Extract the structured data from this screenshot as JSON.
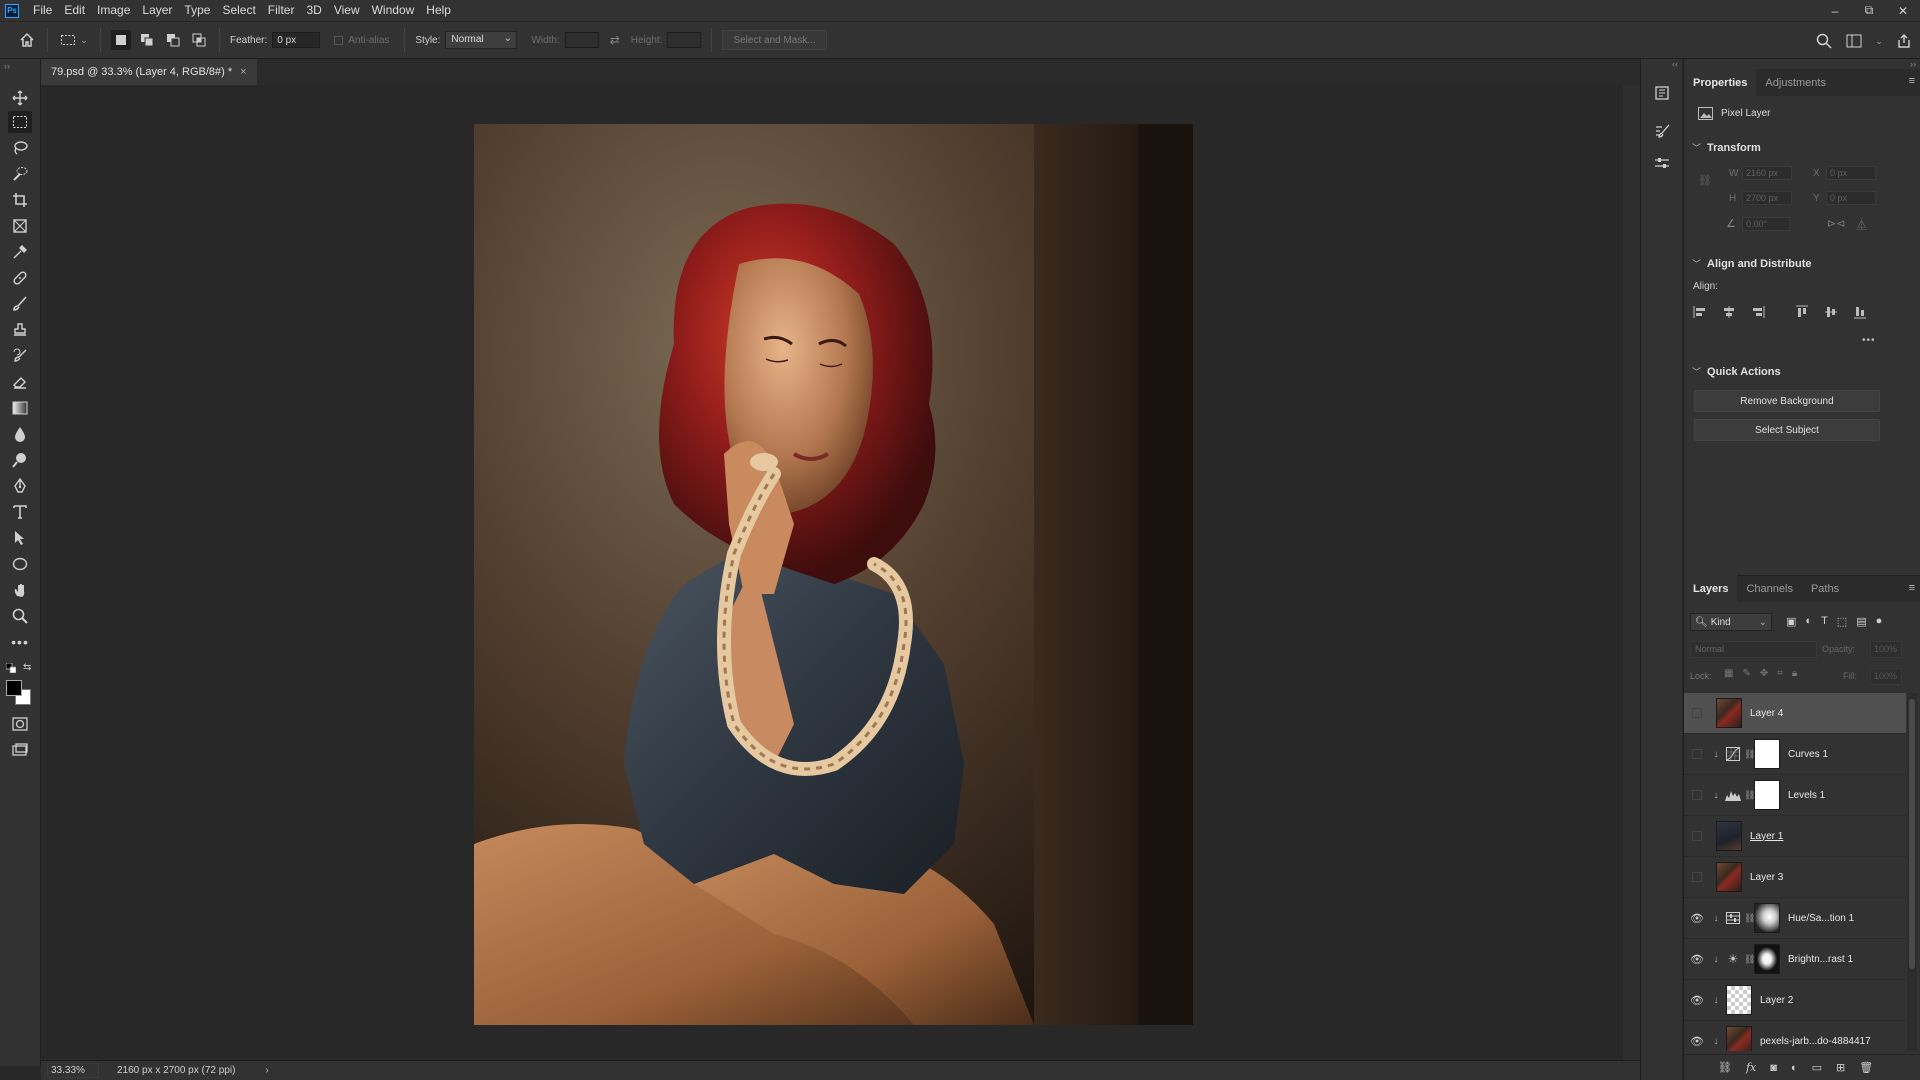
{
  "app": {
    "logo": "Ps",
    "menu": [
      "File",
      "Edit",
      "Image",
      "Layer",
      "Type",
      "Select",
      "Filter",
      "3D",
      "View",
      "Window",
      "Help"
    ],
    "window_controls": {
      "minimize": "–",
      "restore": "⧉",
      "close": "✕"
    }
  },
  "options_bar": {
    "feather_label": "Feather:",
    "feather_value": "0 px",
    "anti_alias_label": "Anti-alias",
    "style_label": "Style:",
    "style_value": "Normal",
    "width_label": "Width:",
    "height_label": "Height:",
    "select_and_mask": "Select and Mask..."
  },
  "document": {
    "tab_title": "79.psd @ 33.3% (Layer 4, RGB/8#) *",
    "tab_close": "×",
    "zoom": "33.33%",
    "dimensions": "2160 px x 2700 px (72 ppi)",
    "status_arrow": "›"
  },
  "properties_panel": {
    "tabs": [
      "Properties",
      "Adjustments"
    ],
    "layer_type": "Pixel Layer",
    "transform": {
      "title": "Transform",
      "w_label": "W",
      "w_value": "2160 px",
      "h_label": "H",
      "h_value": "2700 px",
      "x_label": "X",
      "x_value": "0 px",
      "y_label": "Y",
      "y_value": "0 px",
      "angle_value": "0.00°"
    },
    "align": {
      "title": "Align and Distribute",
      "label": "Align:",
      "more": "•••"
    },
    "quick_actions": {
      "title": "Quick Actions",
      "remove_background": "Remove Background",
      "select_subject": "Select Subject"
    }
  },
  "layers_panel": {
    "tabs": [
      "Layers",
      "Channels",
      "Paths"
    ],
    "kind_label": "Kind",
    "blend_mode": "Normal",
    "opacity_label": "Opacity:",
    "opacity_value": "100%",
    "lock_label": "Lock:",
    "fill_label": "Fill:",
    "fill_value": "100%",
    "layers": [
      {
        "name": "Layer 4",
        "visible": false,
        "selected": true,
        "clipped": false,
        "type": "pixel",
        "thumb": "photo"
      },
      {
        "name": "Curves 1",
        "visible": false,
        "selected": false,
        "clipped": true,
        "type": "adjustment",
        "adj_icon": "curves-icon",
        "mask": "white"
      },
      {
        "name": "Levels 1",
        "visible": false,
        "selected": false,
        "clipped": true,
        "type": "adjustment",
        "adj_icon": "levels-icon",
        "mask": "white"
      },
      {
        "name": "Layer 1",
        "visible": false,
        "selected": false,
        "clipped": false,
        "type": "pixel",
        "thumb": "dark"
      },
      {
        "name": "Layer 3",
        "visible": false,
        "selected": false,
        "clipped": false,
        "type": "pixel",
        "thumb": "photo"
      },
      {
        "name": "Hue/Sa...tion 1",
        "visible": true,
        "selected": false,
        "clipped": true,
        "type": "adjustment",
        "adj_icon": "hue-saturation-icon",
        "mask": "soft"
      },
      {
        "name": "Brightn...rast 1",
        "visible": true,
        "selected": false,
        "clipped": true,
        "type": "adjustment",
        "adj_icon": "brightness-contrast-icon",
        "mask": "spot"
      },
      {
        "name": "Layer 2",
        "visible": true,
        "selected": false,
        "clipped": true,
        "type": "pixel",
        "thumb": "checker"
      },
      {
        "name": "pexels-jarb...do-4884417",
        "visible": true,
        "selected": false,
        "clipped": true,
        "type": "pixel",
        "thumb": "photo"
      }
    ]
  }
}
